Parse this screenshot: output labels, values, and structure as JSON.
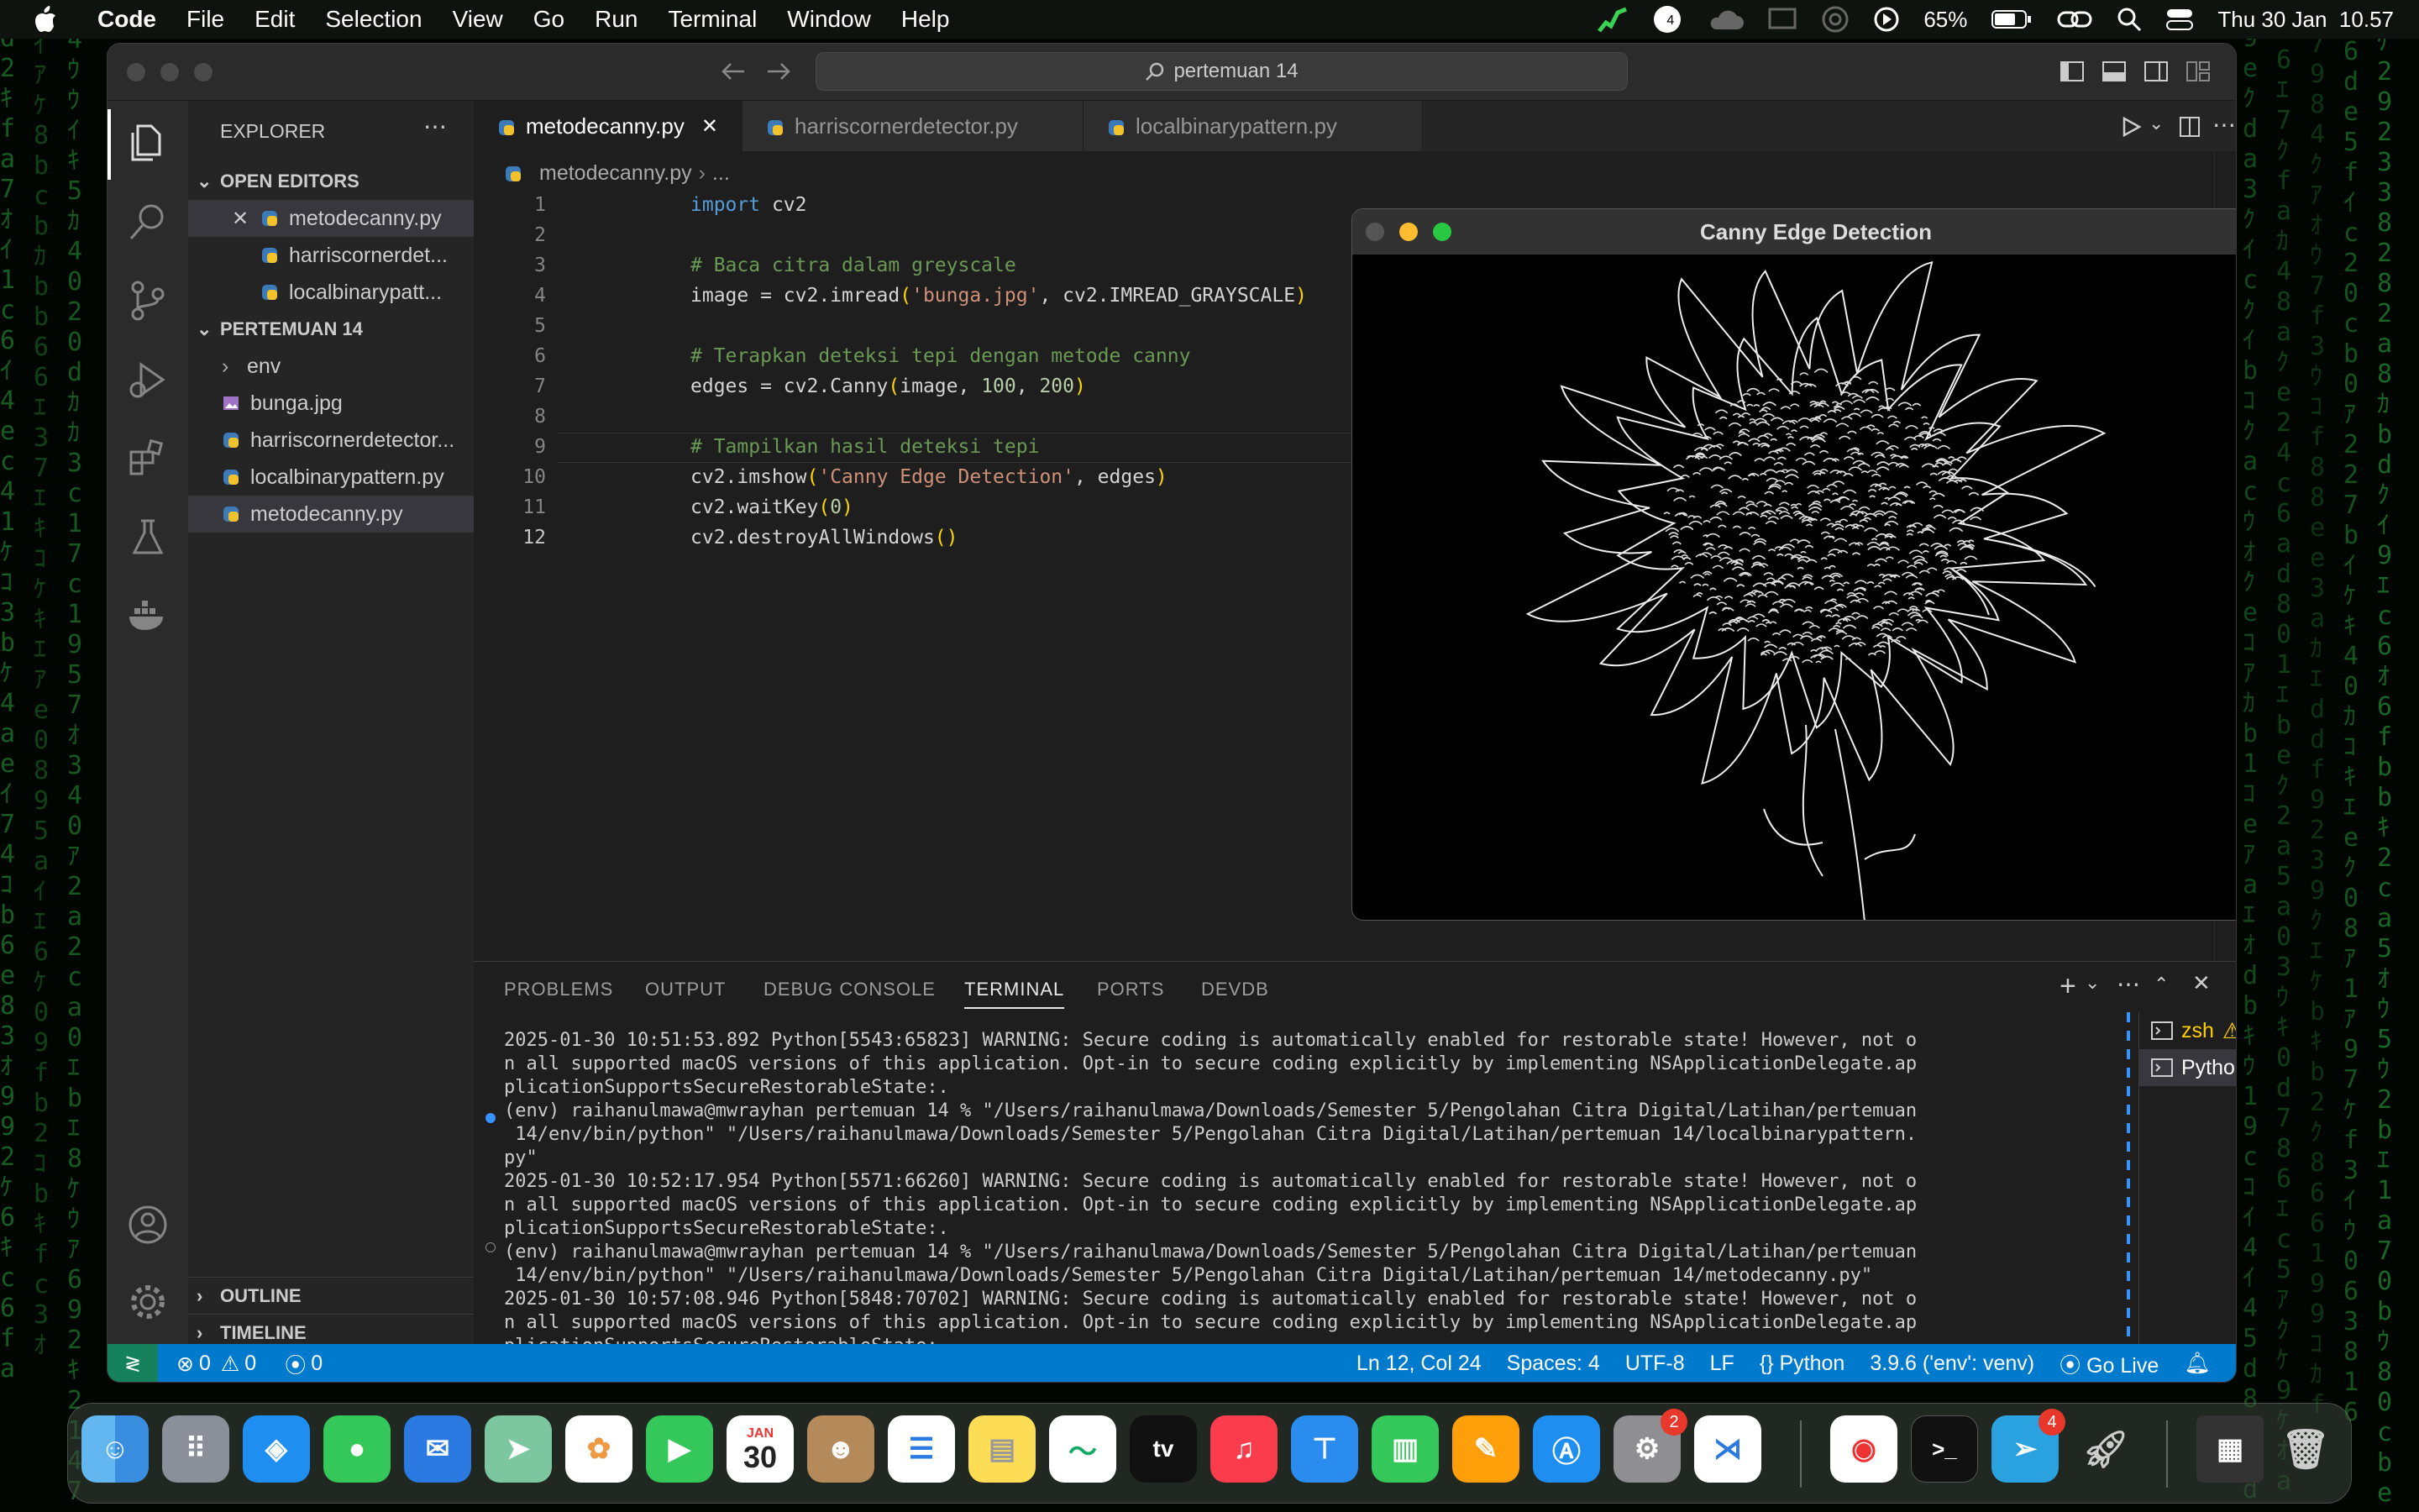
{
  "menubar": {
    "app": "Code",
    "items": [
      "File",
      "Edit",
      "Selection",
      "View",
      "Go",
      "Run",
      "Terminal",
      "Window",
      "Help"
    ],
    "battery": "65%",
    "clock": "Thu 30 Jan  10.57",
    "wifi_badge": "4"
  },
  "window": {
    "search": "pertemuan 14"
  },
  "sidebar": {
    "title": "EXPLORER",
    "open_editors_label": "OPEN EDITORS",
    "open_editors": [
      "metodecanny.py",
      "harriscornerdet...",
      "localbinarypatt..."
    ],
    "folder_label": "PERTEMUAN 14",
    "files": [
      "env",
      "bunga.jpg",
      "harriscornerdetector...",
      "localbinarypattern.py",
      "metodecanny.py"
    ],
    "outline_label": "OUTLINE",
    "timeline_label": "TIMELINE"
  },
  "tabs": [
    "metodecanny.py",
    "harriscornerdetector.py",
    "localbinarypattern.py"
  ],
  "breadcrumb": {
    "file": "metodecanny.py",
    "rest": "..."
  },
  "code": {
    "line_numbers": [
      "1",
      "2",
      "3",
      "4",
      "5",
      "6",
      "7",
      "8",
      "9",
      "10",
      "11",
      "12"
    ],
    "l1_kw": "import",
    "l1_rest": " cv2",
    "l3": "# Baca citra dalam greyscale",
    "l4_a": "image = cv2.imread",
    "l4_b": "(",
    "l4_c": "'bunga.jpg'",
    "l4_d": ", cv2.IMREAD_GRAYSCALE",
    "l4_e": ")",
    "l6": "# Terapkan deteksi tepi dengan metode canny",
    "l7_a": "edges = cv2.Canny",
    "l7_b": "(",
    "l7_c": "image, ",
    "l7_d": "100",
    "l7_e": ", ",
    "l7_f": "200",
    "l7_g": ")",
    "l9": "# Tampilkan hasil deteksi tepi",
    "l10_a": "cv2.imshow",
    "l10_b": "(",
    "l10_c": "'Canny Edge Detection'",
    "l10_d": ", edges",
    "l10_e": ")",
    "l11_a": "cv2.waitKey",
    "l11_b": "(",
    "l11_c": "0",
    "l11_d": ")",
    "l12_a": "cv2.destroyAllWindows",
    "l12_b": "()"
  },
  "cv_window": {
    "title": "Canny Edge Detection"
  },
  "panel": {
    "tabs": [
      "PROBLEMS",
      "OUTPUT",
      "DEBUG CONSOLE",
      "TERMINAL",
      "PORTS",
      "DEVDB"
    ],
    "terminal_lines": [
      "2025-01-30 10:51:53.892 Python[5543:65823] WARNING: Secure coding is automatically enabled for restorable state! However, not o",
      "n all supported macOS versions of this application. Opt-in to secure coding explicitly by implementing NSApplicationDelegate.ap",
      "plicationSupportsSecureRestorableState:.",
      "(env) raihanulmawa@mwrayhan pertemuan 14 % \"/Users/raihanulmawa/Downloads/Semester 5/Pengolahan Citra Digital/Latihan/pertemuan",
      " 14/env/bin/python\" \"/Users/raihanulmawa/Downloads/Semester 5/Pengolahan Citra Digital/Latihan/pertemuan 14/localbinarypattern.",
      "py\"",
      "2025-01-30 10:52:17.954 Python[5571:66260] WARNING: Secure coding is automatically enabled for restorable state! However, not o",
      "n all supported macOS versions of this application. Opt-in to secure coding explicitly by implementing NSApplicationDelegate.ap",
      "plicationSupportsSecureRestorableState:.",
      "(env) raihanulmawa@mwrayhan pertemuan 14 % \"/Users/raihanulmawa/Downloads/Semester 5/Pengolahan Citra Digital/Latihan/pertemuan",
      " 14/env/bin/python\" \"/Users/raihanulmawa/Downloads/Semester 5/Pengolahan Citra Digital/Latihan/pertemuan 14/metodecanny.py\"",
      "2025-01-30 10:57:08.946 Python[5848:70702] WARNING: Secure coding is automatically enabled for restorable state! However, not o",
      "n all supported macOS versions of this application. Opt-in to secure coding explicitly by implementing NSApplicationDelegate.ap",
      "plicationSupportsSecureRestorableState:."
    ],
    "terminals": [
      "zsh",
      "Python"
    ]
  },
  "status": {
    "errors": "0",
    "warnings": "0",
    "ports": "0",
    "position": "Ln 12, Col 24",
    "spaces": "Spaces: 4",
    "encoding": "UTF-8",
    "eol": "LF",
    "language": "Python",
    "interpreter": "3.9.6 ('env': venv)",
    "golive": "Go Live"
  },
  "dock": {
    "calendar_month": "JAN",
    "calendar_day": "30",
    "settings_badge": "2",
    "telegram_badge": "4",
    "tv_label": "tv"
  },
  "colors": {
    "accent": "#007acc",
    "editor_bg": "#1e1e1e",
    "sidebar_bg": "#252526"
  }
}
